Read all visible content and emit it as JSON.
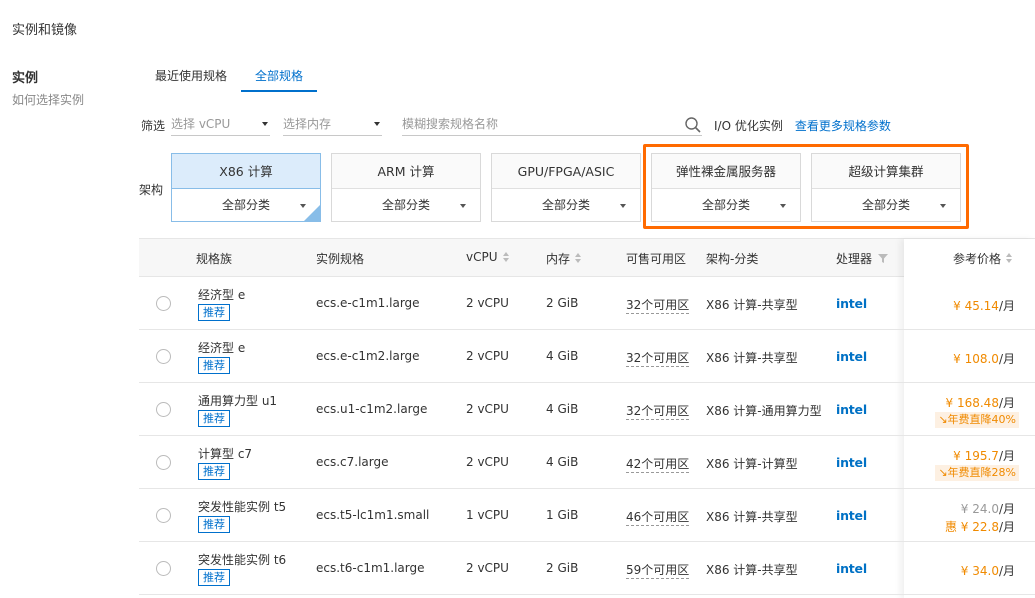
{
  "section_title": "实例和镜像",
  "side": {
    "title": "实例",
    "help_link": "如何选择实例"
  },
  "tabs": [
    {
      "label": "最近使用规格",
      "active": false
    },
    {
      "label": "全部规格",
      "active": true
    }
  ],
  "filters": {
    "label": "筛选",
    "vcpu_placeholder": "选择 vCPU",
    "memory_placeholder": "选择内存",
    "search_placeholder": "模糊搜索规格名称",
    "io_label": "I/O 优化实例",
    "more_link": "查看更多规格参数"
  },
  "arch": {
    "label": "架构",
    "cards": [
      {
        "name": "X86 计算",
        "sub": "全部分类",
        "selected": true
      },
      {
        "name": "ARM 计算",
        "sub": "全部分类",
        "selected": false
      },
      {
        "name": "GPU/FPGA/ASIC",
        "sub": "全部分类",
        "selected": false
      },
      {
        "name": "弹性裸金属服务器",
        "sub": "全部分类",
        "selected": false
      },
      {
        "name": "超级计算集群",
        "sub": "全部分类",
        "selected": false
      }
    ]
  },
  "table": {
    "headers": {
      "family": "规格族",
      "spec": "实例规格",
      "vcpu": "vCPU",
      "memory": "内存",
      "zones": "可售可用区",
      "arch": "架构-分类",
      "cpu": "处理器",
      "price": "参考价格"
    },
    "rows": [
      {
        "family": "经济型 e",
        "badge": "推荐",
        "spec": "ecs.e-c1m1.large",
        "vcpu": "2 vCPU",
        "memory": "2 GiB",
        "zones": "32个可用区",
        "arch": "X86 计算-共享型",
        "cpu": "intel",
        "price": "¥ 45.14",
        "unit": "/月",
        "promo": ""
      },
      {
        "family": "经济型 e",
        "badge": "推荐",
        "spec": "ecs.e-c1m2.large",
        "vcpu": "2 vCPU",
        "memory": "4 GiB",
        "zones": "32个可用区",
        "arch": "X86 计算-共享型",
        "cpu": "intel",
        "price": "¥ 108.0",
        "unit": "/月",
        "promo": ""
      },
      {
        "family": "通用算力型 u1",
        "badge": "推荐",
        "spec": "ecs.u1-c1m2.large",
        "vcpu": "2 vCPU",
        "memory": "4 GiB",
        "zones": "32个可用区",
        "arch": "X86 计算-通用算力型",
        "cpu": "intel",
        "price": "¥ 168.48",
        "unit": "/月",
        "promo": "年费直降40%"
      },
      {
        "family": "计算型 c7",
        "badge": "推荐",
        "spec": "ecs.c7.large",
        "vcpu": "2 vCPU",
        "memory": "4 GiB",
        "zones": "42个可用区",
        "arch": "X86 计算-计算型",
        "cpu": "intel",
        "price": "¥ 195.7",
        "unit": "/月",
        "promo": "年费直降28%"
      },
      {
        "family": "突发性能实例 t5",
        "badge": "推荐",
        "spec": "ecs.t5-lc1m1.small",
        "vcpu": "1 vCPU",
        "memory": "1 GiB",
        "zones": "46个可用区",
        "arch": "X86 计算-共享型",
        "cpu": "intel",
        "price_old": "¥ 24.0",
        "price": "惠 ¥ 22.8",
        "unit": "/月",
        "promo": ""
      },
      {
        "family": "突发性能实例 t6",
        "badge": "推荐",
        "spec": "ecs.t6-c1m1.large",
        "vcpu": "2 vCPU",
        "memory": "2 GiB",
        "zones": "59个可用区",
        "arch": "X86 计算-共享型",
        "cpu": "intel",
        "price": "¥ 34.0",
        "unit": "/月",
        "promo": ""
      }
    ]
  },
  "colors": {
    "accent": "#0070cc",
    "price": "#f08a00",
    "highlight": "#ff6a00"
  }
}
